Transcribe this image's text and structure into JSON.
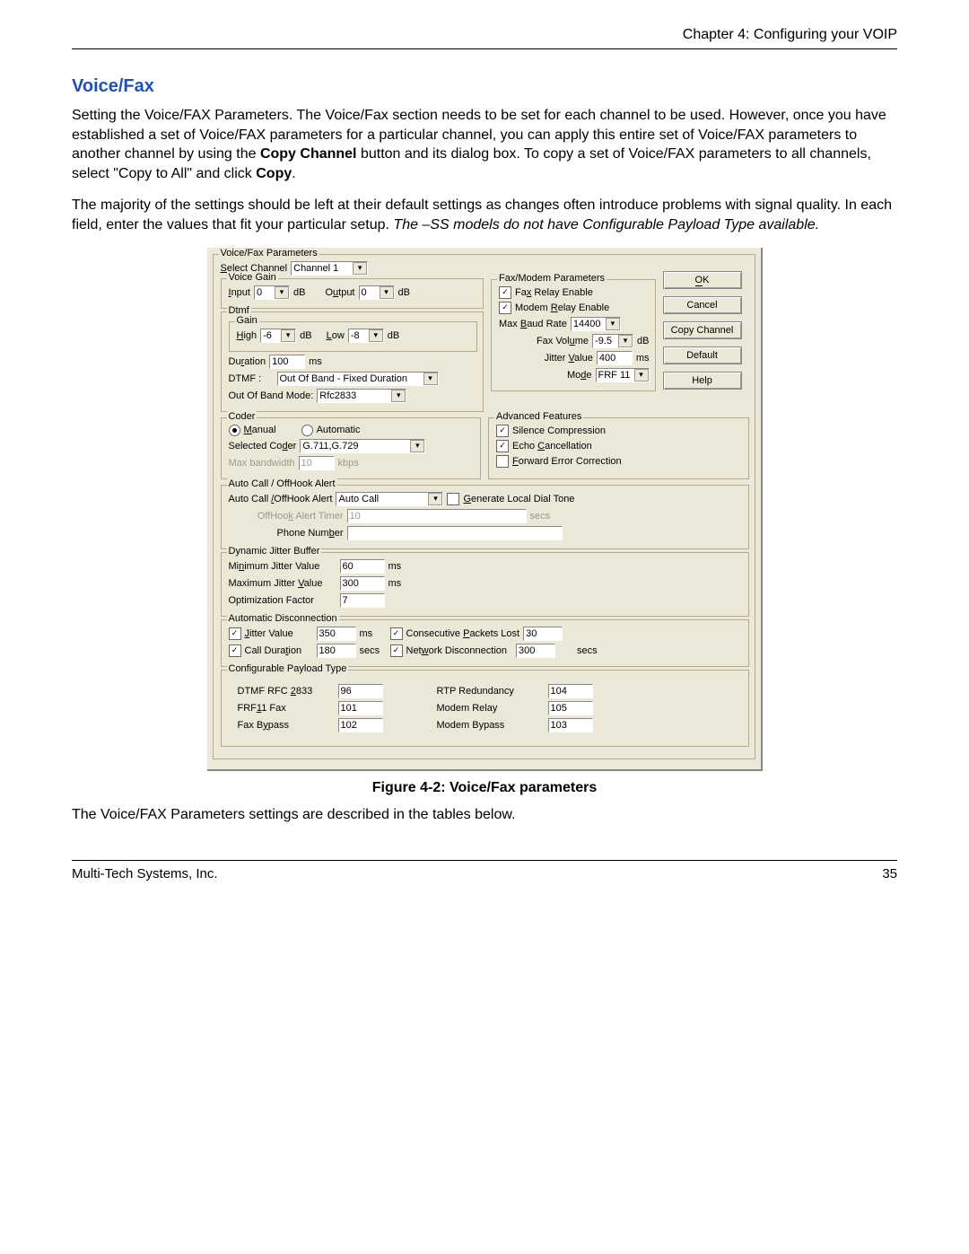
{
  "header": {
    "chapter": "Chapter 4: Configuring your VOIP"
  },
  "section_title": "Voice/Fax",
  "para1_a": "Setting the Voice/FAX Parameters. The Voice/Fax section needs to be set for each channel to be used. However, once you have established a set of Voice/FAX parameters for a particular channel, you can apply this entire set of Voice/FAX parameters to another channel by using the ",
  "para1_bold": "Copy Channel",
  "para1_b": " button and its dialog box. To copy a set of Voice/FAX parameters to all channels, select \"Copy to All\" and click ",
  "para1_bold2": "Copy",
  "para1_c": ".",
  "para2_a": "The majority of the settings should be left at their default settings as changes often introduce problems with signal quality. In each field, enter the values that fit your particular setup. ",
  "para2_italic": "The –SS models do not have Configurable Payload Type available.",
  "figure_caption": "Figure 4-2: Voice/Fax parameters",
  "closing": "The Voice/FAX Parameters settings are described in the tables below.",
  "footer_left": "Multi-Tech Systems, Inc.",
  "footer_right": "35",
  "panel": {
    "group_title": "Voice/Fax Parameters",
    "select_channel_label": "Select Channel",
    "select_channel_value": "Channel 1",
    "voice_gain": {
      "title": "Voice Gain",
      "input_label": "Input",
      "input_value": "0",
      "db": "dB",
      "output_label": "Output",
      "output_value": "0"
    },
    "dtmf": {
      "title": "Dtmf",
      "gain_title": "Gain",
      "high_label": "High",
      "high_value": "-6",
      "low_label": "Low",
      "low_value": "-8",
      "db": "dB",
      "duration_label": "Duration",
      "duration_value": "100",
      "ms": "ms",
      "dtmf_label": "DTMF :",
      "dtmf_value": "Out Of Band - Fixed Duration",
      "oob_label": "Out Of Band Mode:",
      "oob_value": "Rfc2833"
    },
    "fax_modem": {
      "title": "Fax/Modem Parameters",
      "fax_relay": "Fax Relay Enable",
      "modem_relay": "Modem Relay Enable",
      "max_baud_label": "Max Baud Rate",
      "max_baud_value": "14400",
      "fax_volume_label": "Fax Volume",
      "fax_volume_value": "-9.5",
      "db": "dB",
      "jitter_label": "Jitter Value",
      "jitter_value": "400",
      "ms": "ms",
      "mode_label": "Mode",
      "mode_value": "FRF 11"
    },
    "buttons": {
      "ok": "OK",
      "cancel": "Cancel",
      "copy_channel": "Copy Channel",
      "default": "Default",
      "help": "Help"
    },
    "coder": {
      "title": "Coder",
      "manual": "Manual",
      "automatic": "Automatic",
      "selected_coder_label": "Selected Coder",
      "selected_coder_value": "G.711,G.729",
      "max_bw_label": "Max bandwidth",
      "max_bw_value": "10",
      "kbps": "kbps"
    },
    "adv": {
      "title": "Advanced Features",
      "silence": "Silence Compression",
      "echo": "Echo Cancellation",
      "fec": "Forward Error Correction"
    },
    "autocall": {
      "title": "Auto Call / OffHook Alert",
      "ac_label": "Auto Call /OffHook Alert",
      "ac_value": "Auto Call",
      "gen_dial": "Generate Local Dial Tone",
      "timer_label": "OffHook Alert Timer",
      "timer_value": "10",
      "secs": "secs",
      "phone_label": "Phone Number",
      "phone_value": ""
    },
    "jitter": {
      "title": "Dynamic Jitter Buffer",
      "min_label": "Minimum Jitter Value",
      "min_value": "60",
      "max_label": "Maximum Jitter Value",
      "max_value": "300",
      "opt_label": "Optimization Factor",
      "opt_value": "7",
      "ms": "ms"
    },
    "autodisc": {
      "title": "Automatic Disconnection",
      "jitter_label": "Jitter Value",
      "jitter_value": "350",
      "ms": "ms",
      "call_dur_label": "Call Duration",
      "call_dur_value": "180",
      "secs": "secs",
      "cpl_label": "Consecutive Packets Lost",
      "cpl_value": "30",
      "net_label": "Network Disconnection",
      "net_value": "300"
    },
    "cpt": {
      "title": "Configurable Payload Type",
      "dtmf_label": "DTMF RFC 2833",
      "dtmf_value": "96",
      "frf_label": "FRF11 Fax",
      "frf_value": "101",
      "fb_label": "Fax Bypass",
      "fb_value": "102",
      "rtp_label": "RTP Redundancy",
      "rtp_value": "104",
      "mr_label": "Modem Relay",
      "mr_value": "105",
      "mb_label": "Modem Bypass",
      "mb_value": "103"
    }
  }
}
